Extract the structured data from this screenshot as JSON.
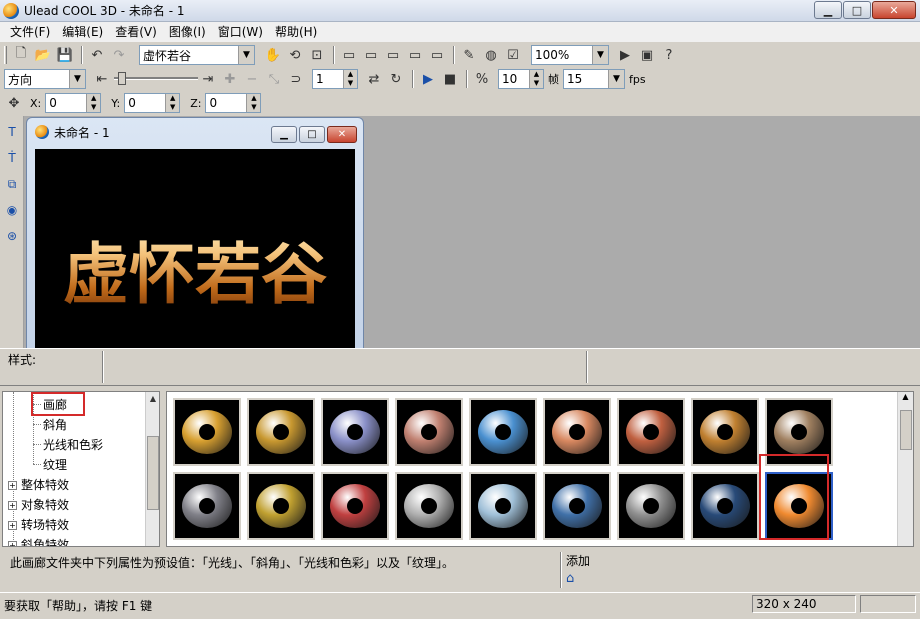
{
  "window": {
    "title": "Ulead COOL 3D - 未命名 - 1"
  },
  "menu": [
    "文件(F)",
    "编辑(E)",
    "查看(V)",
    "图像(I)",
    "窗口(W)",
    "帮助(H)"
  ],
  "toolbar1": {
    "text_combo": "虚怀若谷",
    "zoom": "100%"
  },
  "toolbar2": {
    "direction": "方向",
    "frame_value": "1",
    "fps_value": "10",
    "frame_label": "帧",
    "fps_combo": "15",
    "fps_label": "fps"
  },
  "toolbar3": {
    "x_label": "X:",
    "x_value": "0",
    "y_label": "Y:",
    "y_value": "0",
    "z_label": "Z:",
    "z_value": "0"
  },
  "document": {
    "title": "未命名 - 1",
    "canvas_text": "虚怀若谷"
  },
  "style_panel": {
    "label": "样式:"
  },
  "tree": {
    "items": [
      {
        "label": "画廊",
        "type": "child"
      },
      {
        "label": "斜角",
        "type": "child"
      },
      {
        "label": "光线和色彩",
        "type": "child"
      },
      {
        "label": "纹理",
        "type": "child"
      },
      {
        "label": "整体特效",
        "type": "group"
      },
      {
        "label": "对象特效",
        "type": "group"
      },
      {
        "label": "转场特效",
        "type": "group"
      },
      {
        "label": "斜角特效",
        "type": "group"
      }
    ]
  },
  "gallery": {
    "thumbnails": [
      {
        "name": "gold-ring",
        "color": "#d8a030"
      },
      {
        "name": "gold-ring-2",
        "color": "#c89830"
      },
      {
        "name": "silver-blue-ring",
        "color": "#8a90c8"
      },
      {
        "name": "copper-ring",
        "color": "#c08070"
      },
      {
        "name": "blue-marble-ring",
        "color": "#4a90d0"
      },
      {
        "name": "rose-gold-ring",
        "color": "#d88860"
      },
      {
        "name": "red-clay-ring",
        "color": "#c06040"
      },
      {
        "name": "amber-ring",
        "color": "#c08030"
      },
      {
        "name": "studded-ring",
        "color": "#a08060"
      },
      {
        "name": "dotted-grey-ring",
        "color": "#808088"
      },
      {
        "name": "yellow-black-ring",
        "color": "#c0a030"
      },
      {
        "name": "color-segment-ring",
        "color": "#c04040"
      },
      {
        "name": "chrome-ring",
        "color": "#b0b0b0"
      },
      {
        "name": "pale-blue-ring",
        "color": "#a0c0d8"
      },
      {
        "name": "blue-white-ring",
        "color": "#4070a8"
      },
      {
        "name": "steel-ring",
        "color": "#909090"
      },
      {
        "name": "dark-blue-ring",
        "color": "#284a78"
      },
      {
        "name": "orange-glow-ring",
        "color": "#f08a30"
      }
    ]
  },
  "description": {
    "text": "此画廊文件夹中下列属性为预设值：「光线」、「斜角」、「光线和色彩」以及「纹理」。",
    "add_label": "添加"
  },
  "status": {
    "help_text": "要获取「帮助」，请按 F1 键",
    "size": "320 x 240"
  }
}
